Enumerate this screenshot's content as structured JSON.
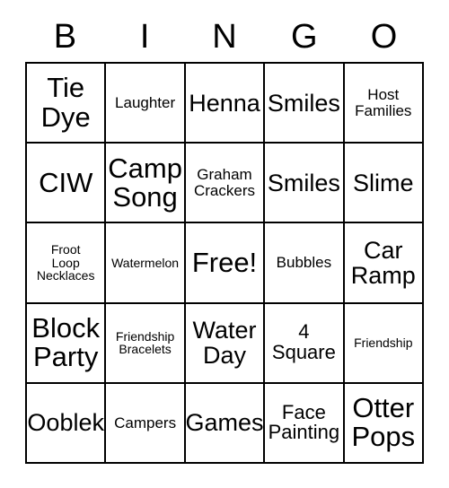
{
  "card": {
    "title_letters": [
      "B",
      "I",
      "N",
      "G",
      "O"
    ],
    "border_color": "#000000",
    "background_color": "#ffffff",
    "text_color": "#000000",
    "rows": 5,
    "columns": 5,
    "cells": [
      [
        {
          "label": "Tie\nDye",
          "size": "xl"
        },
        {
          "label": "Laughter",
          "size": "sm"
        },
        {
          "label": "Henna",
          "size": "lg"
        },
        {
          "label": "Smiles",
          "size": "lg"
        },
        {
          "label": "Host\nFamilies",
          "size": "sm"
        }
      ],
      [
        {
          "label": "CIW",
          "size": "xl"
        },
        {
          "label": "Camp\nSong",
          "size": "xl"
        },
        {
          "label": "Graham\nCrackers",
          "size": "sm"
        },
        {
          "label": "Smiles",
          "size": "lg"
        },
        {
          "label": "Slime",
          "size": "lg"
        }
      ],
      [
        {
          "label": "Froot\nLoop\nNecklaces",
          "size": "xs"
        },
        {
          "label": "Watermelon",
          "size": "xs"
        },
        {
          "label": "Free!",
          "size": "xl"
        },
        {
          "label": "Bubbles",
          "size": "sm"
        },
        {
          "label": "Car\nRamp",
          "size": "lg"
        }
      ],
      [
        {
          "label": "Block\nParty",
          "size": "xl"
        },
        {
          "label": "Friendship\nBracelets",
          "size": "xs"
        },
        {
          "label": "Water\nDay",
          "size": "lg"
        },
        {
          "label": "4\nSquare",
          "size": "md"
        },
        {
          "label": "Friendship",
          "size": "xs"
        }
      ],
      [
        {
          "label": "Ooblek",
          "size": "lg"
        },
        {
          "label": "Campers",
          "size": "sm"
        },
        {
          "label": "Games",
          "size": "lg"
        },
        {
          "label": "Face\nPainting",
          "size": "md"
        },
        {
          "label": "Otter\nPops",
          "size": "xl"
        }
      ]
    ]
  }
}
